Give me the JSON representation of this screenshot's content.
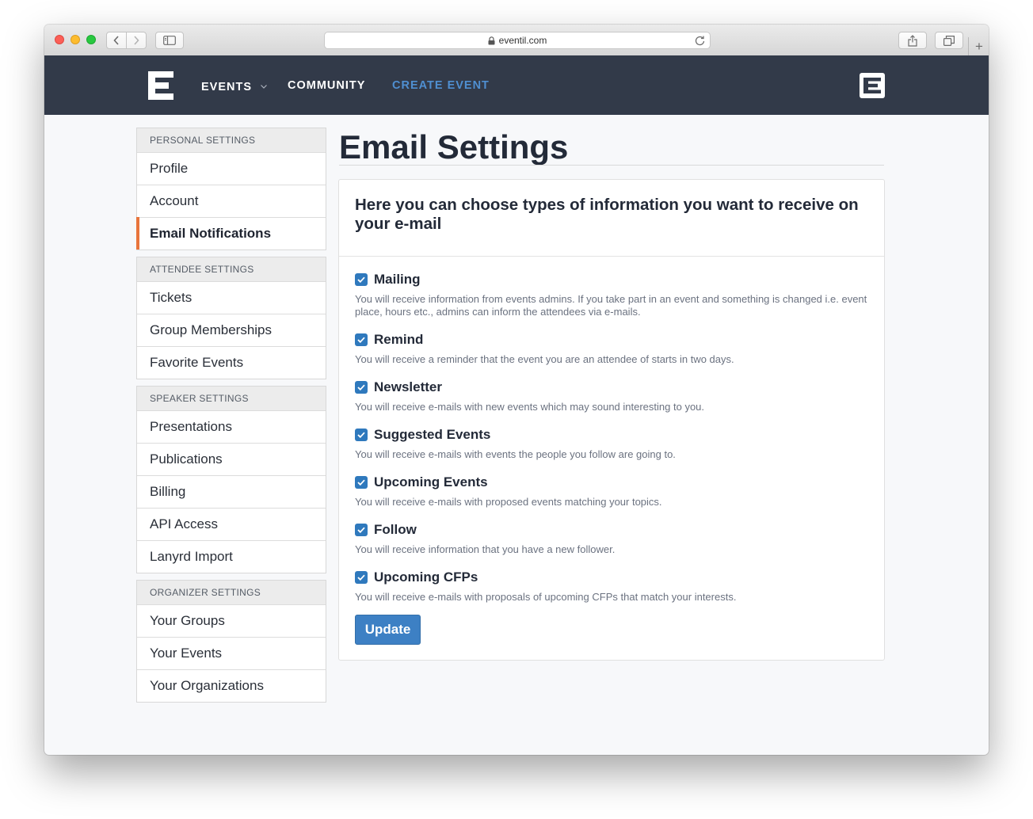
{
  "browser": {
    "url": "eventil.com"
  },
  "nav": {
    "events": "EVENTS",
    "community": "COMMUNITY",
    "create_event": "CREATE EVENT"
  },
  "sidebar": {
    "personal": {
      "header": "PERSONAL SETTINGS",
      "items": [
        "Profile",
        "Account",
        "Email Notifications"
      ]
    },
    "attendee": {
      "header": "ATTENDEE SETTINGS",
      "items": [
        "Tickets",
        "Group Memberships",
        "Favorite Events"
      ]
    },
    "speaker": {
      "header": "SPEAKER SETTINGS",
      "items": [
        "Presentations",
        "Publications",
        "Billing",
        "API Access",
        "Lanyrd Import"
      ]
    },
    "organizer": {
      "header": "ORGANIZER SETTINGS",
      "items": [
        "Your Groups",
        "Your Events",
        "Your Organizations"
      ]
    },
    "active_item": "Email Notifications"
  },
  "main": {
    "title": "Email Settings",
    "intro": "Here you can choose types of information you want to receive on your e-mail",
    "options": [
      {
        "label": "Mailing",
        "checked": true,
        "desc": "You will receive information from events admins. If you take part in an event and something is changed i.e. event place, hours etc., admins can inform the attendees via e-mails."
      },
      {
        "label": "Remind",
        "checked": true,
        "desc": "You will receive a reminder that the event you are an attendee of starts in two days."
      },
      {
        "label": "Newsletter",
        "checked": true,
        "desc": "You will receive e-mails with new events which may sound interesting to you."
      },
      {
        "label": "Suggested Events",
        "checked": true,
        "desc": "You will receive e-mails with events the people you follow are going to."
      },
      {
        "label": "Upcoming Events",
        "checked": true,
        "desc": "You will receive e-mails with proposed events matching your topics."
      },
      {
        "label": "Follow",
        "checked": true,
        "desc": "You will receive information that you have a new follower."
      },
      {
        "label": "Upcoming CFPs",
        "checked": true,
        "desc": "You will receive e-mails with proposals of upcoming CFPs that match your interests."
      }
    ],
    "update_label": "Update"
  },
  "colors": {
    "header_bg": "#323a49",
    "accent": "#e8743b",
    "link_blue": "#4f8fd1",
    "checkbox": "#2f79bd",
    "button": "#3d80c4"
  }
}
